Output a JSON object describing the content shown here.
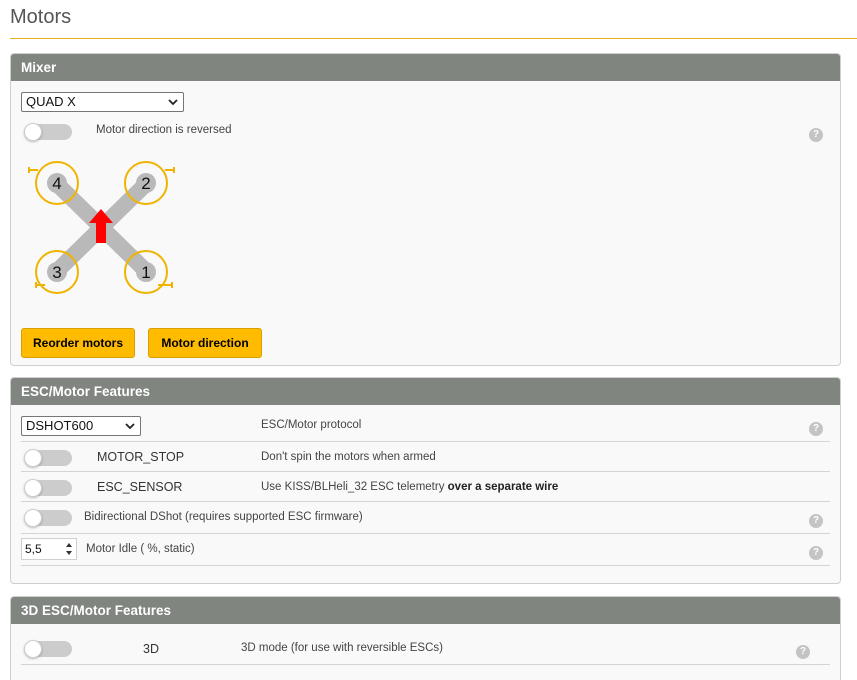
{
  "page": {
    "title": "Motors"
  },
  "mixer": {
    "header": "Mixer",
    "mixer_select": "QUAD X",
    "reversed_label": "Motor direction is reversed",
    "reversed_on": false,
    "motor_labels": [
      "4",
      "2",
      "3",
      "1"
    ],
    "reorder_button": "Reorder motors",
    "direction_button": "Motor direction"
  },
  "esc": {
    "header": "ESC/Motor Features",
    "protocol_select": "DSHOT600",
    "protocol_label": "ESC/Motor protocol",
    "motor_stop_name": "MOTOR_STOP",
    "motor_stop_desc": "Don't spin the motors when armed",
    "esc_sensor_name": "ESC_SENSOR",
    "esc_sensor_desc": "Use KISS/BLHeli_32 ESC telemetry",
    "esc_sensor_desc_bold": "over a separate wire",
    "bidir_label": "Bidirectional DShot (requires supported ESC firmware)",
    "idle_value": "5,5",
    "idle_label": "Motor Idle ( %, static)"
  },
  "esc3d": {
    "header": "3D ESC/Motor Features",
    "name": "3D",
    "desc": "3D mode (for use with reversible ESCs)"
  },
  "help_glyph": "?",
  "colors": {
    "accent": "#ffbb00",
    "header": "#808580",
    "arrow": "#ff0000",
    "prop": "#f0b400"
  }
}
